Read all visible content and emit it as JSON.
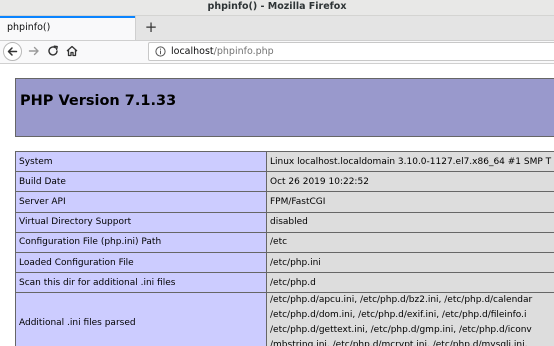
{
  "window": {
    "title": "phpinfo() - Mozilla Firefox"
  },
  "tabs": [
    {
      "label": "phpinfo()",
      "active": true
    }
  ],
  "new_tab_symbol": "+",
  "urlbar": {
    "host": "localhost",
    "path": "/phpinfo.php"
  },
  "icons": {
    "back": "back-arrow-icon",
    "forward": "forward-arrow-icon",
    "reload": "reload-icon",
    "home": "home-icon",
    "site_info": "info-icon"
  },
  "colors": {
    "header_bg": "#9999cc",
    "label_bg": "#ccccff",
    "value_bg": "#dddddd",
    "tab_accent": "#0a84ff"
  },
  "page": {
    "title": "PHP Version 7.1.33",
    "rows": [
      {
        "label": "System",
        "value": "Linux localhost.localdomain 3.10.0-1127.el7.x86_64 #1 SMP T"
      },
      {
        "label": "Build Date",
        "value": "Oct 26 2019 10:22:52"
      },
      {
        "label": "Server API",
        "value": "FPM/FastCGI"
      },
      {
        "label": "Virtual Directory Support",
        "value": "disabled"
      },
      {
        "label": "Configuration File (php.ini) Path",
        "value": "/etc"
      },
      {
        "label": "Loaded Configuration File",
        "value": "/etc/php.ini"
      },
      {
        "label": "Scan this dir for additional .ini files",
        "value": "/etc/php.d"
      }
    ],
    "additional": {
      "label": "Additional .ini files parsed",
      "lines": [
        "/etc/php.d/apcu.ini, /etc/php.d/bz2.ini, /etc/php.d/calendar",
        "/etc/php.d/dom.ini, /etc/php.d/exif.ini, /etc/php.d/fileinfo.i",
        "/etc/php.d/gettext.ini, /etc/php.d/gmp.ini, /etc/php.d/iconv",
        "/mbstring.ini, /etc/php.d/mcrypt.ini, /etc/php.d/mysqli.ini,"
      ]
    }
  }
}
